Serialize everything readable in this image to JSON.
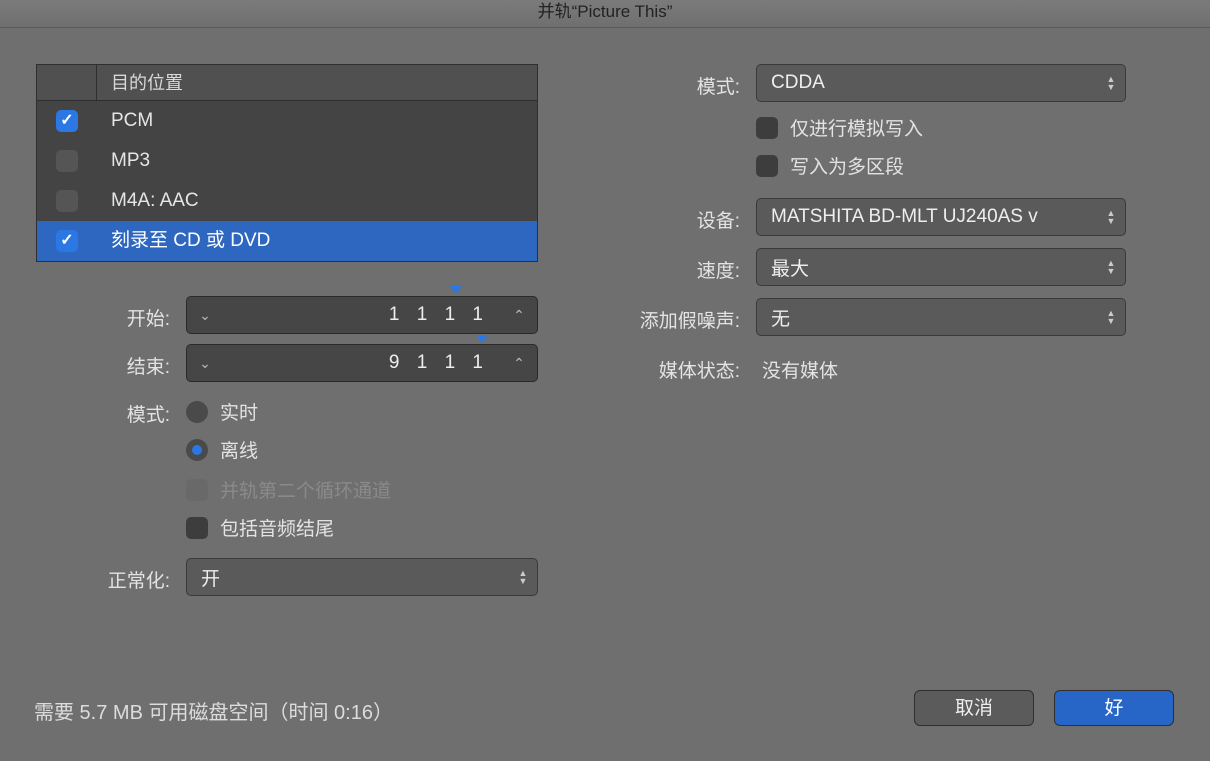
{
  "window": {
    "title": "并轨“Picture This”"
  },
  "dest": {
    "header": "目的位置",
    "rows": [
      {
        "label": "PCM",
        "checked": true,
        "selected": false
      },
      {
        "label": "MP3",
        "checked": false,
        "selected": false
      },
      {
        "label": "M4A: AAC",
        "checked": false,
        "selected": false
      },
      {
        "label": "刻录至 CD 或 DVD",
        "checked": true,
        "selected": true
      }
    ]
  },
  "left": {
    "start_label": "开始:",
    "start_value": "1 1 1    1",
    "end_label": "结束:",
    "end_value": "9 1 1    1",
    "mode_label": "模式:",
    "realtime": "实时",
    "offline": "离线",
    "second_cycle": "并轨第二个循环通道",
    "include_tail": "包括音频结尾",
    "normalize_label": "正常化:",
    "normalize_value": "开"
  },
  "right": {
    "mode_label": "模式:",
    "mode_value": "CDDA",
    "simulate": "仅进行模拟写入",
    "multisession": "写入为多区段",
    "device_label": "设备:",
    "device_value": "MATSHITA BD-MLT UJ240AS v",
    "speed_label": "速度:",
    "speed_value": "最大",
    "dither_label": "添加假噪声:",
    "dither_value": "无",
    "media_label": "媒体状态:",
    "media_value": "没有媒体"
  },
  "footer": {
    "status": "需要 5.7 MB 可用磁盘空间（时间 0:16）",
    "cancel": "取消",
    "ok": "好"
  }
}
